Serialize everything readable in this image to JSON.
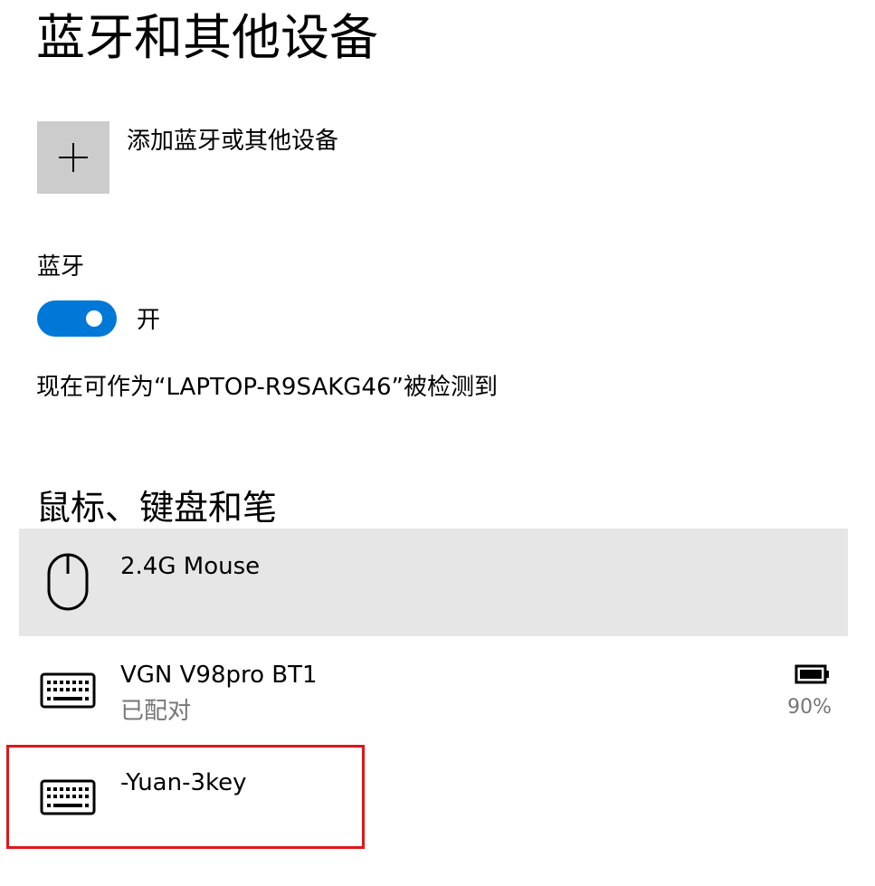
{
  "header": {
    "title": "蓝牙和其他设备"
  },
  "add_device": {
    "label": "添加蓝牙或其他设备",
    "icon": "plus-icon"
  },
  "bluetooth": {
    "label": "蓝牙",
    "toggle_state": "开",
    "toggle_on": true,
    "discoverable_text": "现在可作为“LAPTOP-R9SAKG46”被检测到",
    "accent_color": "#0078d7"
  },
  "section": {
    "title": "鼠标、键盘和笔"
  },
  "devices": [
    {
      "name": "2.4G Mouse",
      "icon": "mouse-icon",
      "selected": true
    },
    {
      "name": "VGN V98pro BT1",
      "status": "已配对",
      "icon": "keyboard-icon",
      "battery": "90%",
      "battery_icon": "battery-icon"
    },
    {
      "name": "-Yuan-3key",
      "icon": "keyboard-icon",
      "highlighted": true,
      "highlight_color": "#e0161b"
    }
  ]
}
